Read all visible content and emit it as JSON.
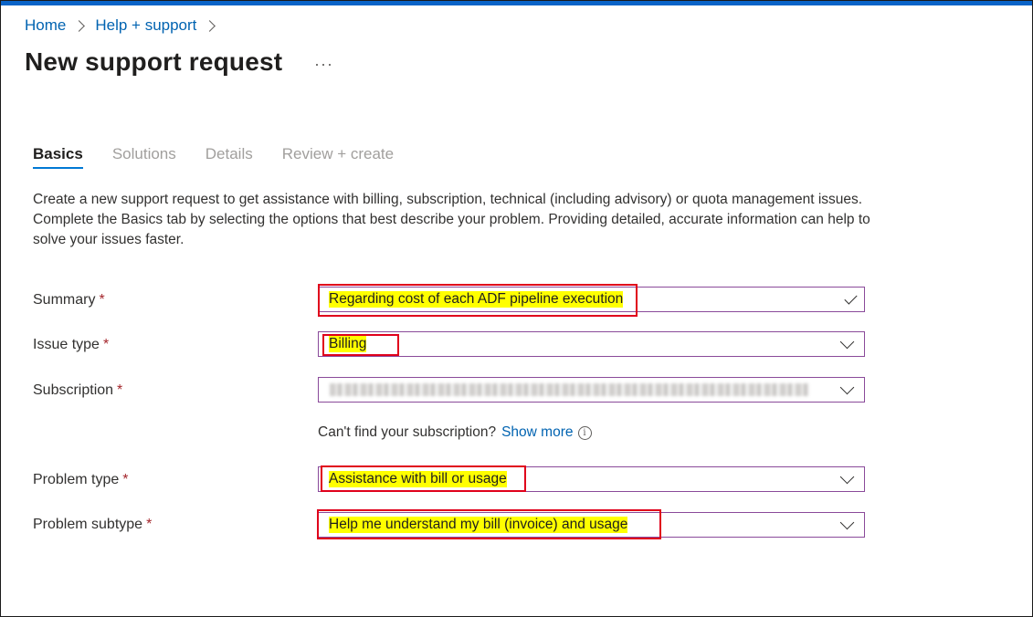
{
  "breadcrumb": {
    "items": [
      "Home",
      "Help + support"
    ]
  },
  "page": {
    "title": "New support request",
    "more": "···"
  },
  "tabs": [
    {
      "label": "Basics",
      "active": true
    },
    {
      "label": "Solutions",
      "active": false
    },
    {
      "label": "Details",
      "active": false
    },
    {
      "label": "Review + create",
      "active": false
    }
  ],
  "description": {
    "line1": "Create a new support request to get assistance with billing, subscription, technical (including advisory) or quota management issues.",
    "line2": "Complete the Basics tab by selecting the options that best describe your problem. Providing detailed, accurate information can help to solve your issues faster."
  },
  "form": {
    "required_mark": "*",
    "summary": {
      "label": "Summary",
      "value": "Regarding cost of each ADF pipeline execution"
    },
    "issue_type": {
      "label": "Issue type",
      "value": "Billing"
    },
    "subscription": {
      "label": "Subscription",
      "value": ""
    },
    "subscription_hint": {
      "text": "Can't find your subscription?",
      "link": "Show more",
      "info_glyph": "i"
    },
    "problem_type": {
      "label": "Problem type",
      "value": "Assistance with bill or usage"
    },
    "problem_subtype": {
      "label": "Problem subtype",
      "value": "Help me understand my bill (invoice) and usage"
    }
  },
  "colors": {
    "accent": "#0078d4",
    "link": "#0063b1",
    "highlight": "#ffff00",
    "annotation": "#e0001b",
    "field_border": "#8a4a9a"
  }
}
